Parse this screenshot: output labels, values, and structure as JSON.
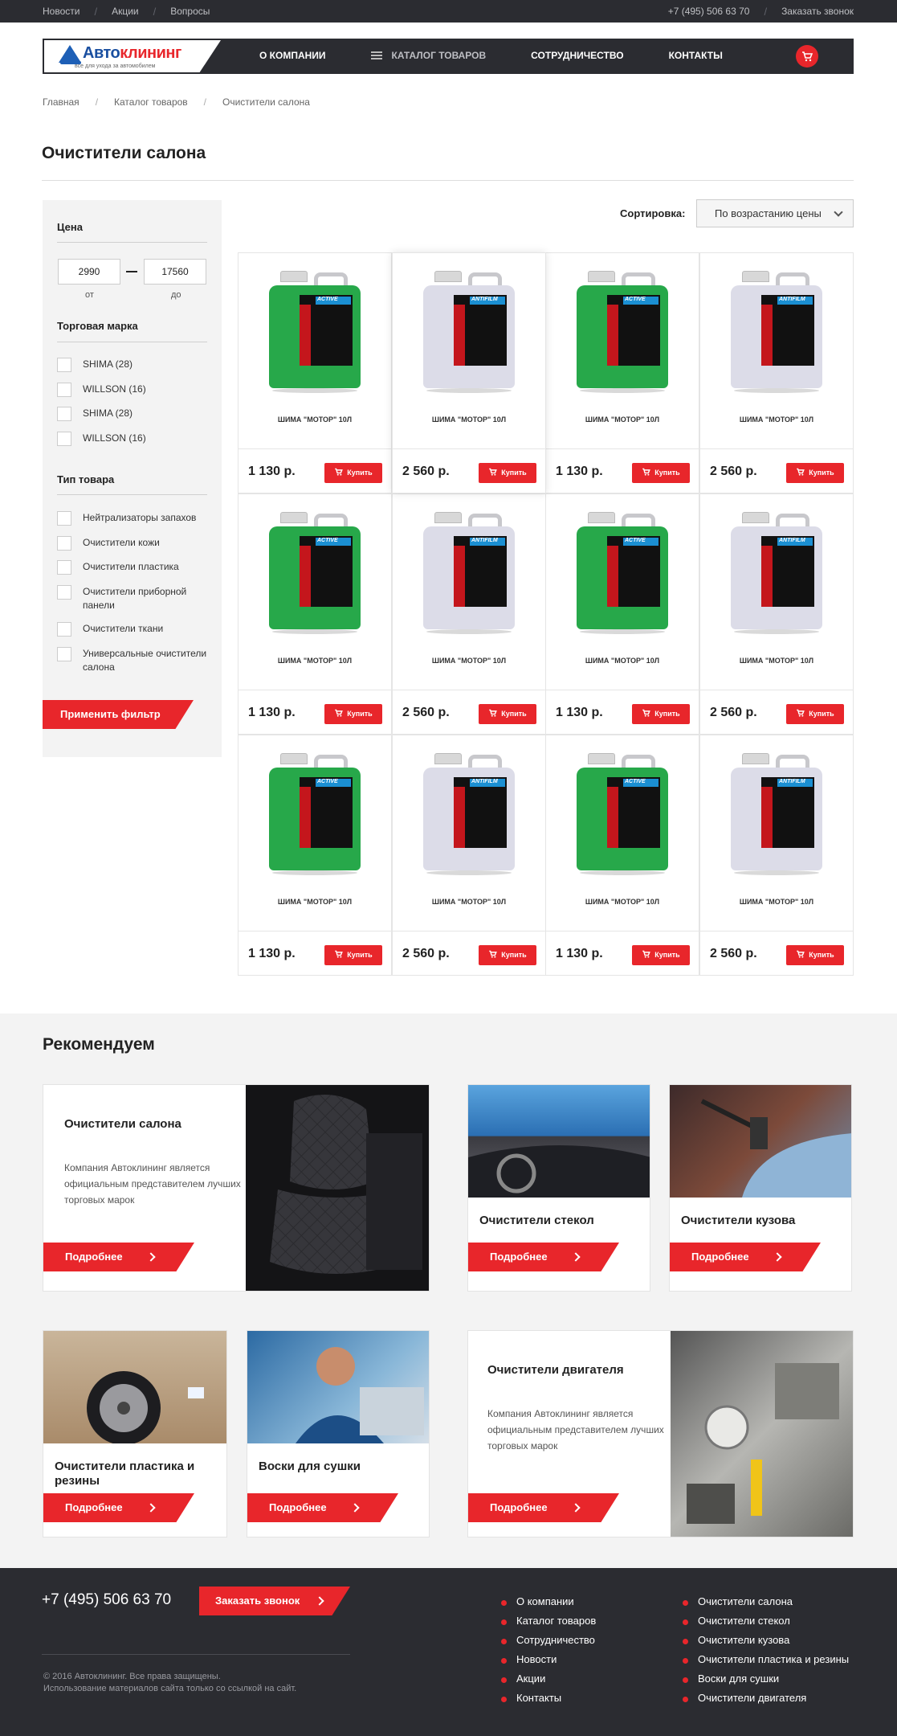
{
  "topbar": {
    "nav": [
      "Новости",
      "Акции",
      "Вопросы"
    ],
    "phone": "+7 (495) 506 63 70",
    "callback": "Заказать звонок"
  },
  "header": {
    "logo_main": "Авто",
    "logo_accent": "клининг",
    "logo_tagline": "все для ухода за автомобилем",
    "nav": {
      "about": "О КОМПАНИИ",
      "catalog": "КАТАЛОГ ТОВАРОВ",
      "partners": "СОТРУДНИЧЕСТВО",
      "contacts": "КОНТАКТЫ"
    },
    "cart_icon": "cart-icon"
  },
  "breadcrumbs": [
    "Главная",
    "Каталог товаров",
    "Очистители салона"
  ],
  "page_title": "Очистители салона",
  "filter": {
    "price_heading": "Цена",
    "price_from": "2990",
    "price_to": "17560",
    "from_label": "от",
    "to_label": "до",
    "brand_heading": "Торговая марка",
    "brands": [
      "SHIMA (28)",
      "WILLSON (16)",
      "SHIMA (28)",
      "WILLSON (16)"
    ],
    "type_heading": "Тип товара",
    "types": [
      "Нейтрализаторы запахов",
      "Очистители кожи",
      "Очистители пластика",
      "Очистители приборной панели",
      "Очистители ткани",
      "Универсальные очистители салона"
    ],
    "apply_label": "Применить фильтр"
  },
  "sort": {
    "label": "Сортировка:",
    "value": "По возрастанию цены"
  },
  "products": [
    {
      "name": "ШИМА \"МОТОР\" 10Л",
      "price": "1 130 р.",
      "buy": "Купить",
      "color": "green",
      "label": "ACTIVE"
    },
    {
      "name": "ШИМА \"МОТОР\" 10Л",
      "price": "2 560 р.",
      "buy": "Купить",
      "color": "white",
      "label": "ANTIFILM"
    },
    {
      "name": "ШИМА \"МОТОР\" 10Л",
      "price": "1 130 р.",
      "buy": "Купить",
      "color": "green",
      "label": "ACTIVE"
    },
    {
      "name": "ШИМА \"МОТОР\" 10Л",
      "price": "2 560 р.",
      "buy": "Купить",
      "color": "white",
      "label": "ANTIFILM"
    },
    {
      "name": "ШИМА \"МОТОР\" 10Л",
      "price": "1 130 р.",
      "buy": "Купить",
      "color": "green",
      "label": "ACTIVE"
    },
    {
      "name": "ШИМА \"МОТОР\" 10Л",
      "price": "2 560 р.",
      "buy": "Купить",
      "color": "white",
      "label": "ANTIFILM"
    },
    {
      "name": "ШИМА \"МОТОР\" 10Л",
      "price": "1 130 р.",
      "buy": "Купить",
      "color": "green",
      "label": "ACTIVE"
    },
    {
      "name": "ШИМА \"МОТОР\" 10Л",
      "price": "2 560 р.",
      "buy": "Купить",
      "color": "white",
      "label": "ANTIFILM"
    },
    {
      "name": "ШИМА \"МОТОР\" 10Л",
      "price": "1 130 р.",
      "buy": "Купить",
      "color": "green",
      "label": "ACTIVE"
    },
    {
      "name": "ШИМА \"МОТОР\" 10Л",
      "price": "2 560 р.",
      "buy": "Купить",
      "color": "white",
      "label": "ANTIFILM"
    },
    {
      "name": "ШИМА \"МОТОР\" 10Л",
      "price": "1 130 р.",
      "buy": "Купить",
      "color": "green",
      "label": "ACTIVE"
    },
    {
      "name": "ШИМА \"МОТОР\" 10Л",
      "price": "2 560 р.",
      "buy": "Купить",
      "color": "white",
      "label": "ANTIFILM"
    }
  ],
  "recommended": {
    "heading": "Рекомендуем",
    "more_label": "Подробнее",
    "description": "Компания Автоклининг является официальным представителем лучших торговых марок",
    "items": [
      "Очистители салона",
      "Очистители стекол",
      "Очистители кузова",
      "Очистители пластика и резины",
      "Воски для сушки",
      "Очистители двигателя"
    ]
  },
  "footer": {
    "phone": "+7 (495) 506 63 70",
    "callback": "Заказать звонок",
    "copyright_line1": "© 2016 Автоклининг. Все права защищены.",
    "copyright_line2": "Использование материалов сайта только со ссылкой на сайт.",
    "links_col1": [
      "О компании",
      "Каталог товаров",
      "Сотрудничество",
      "Новости",
      "Акции",
      "Контакты"
    ],
    "links_col2": [
      "Очистители салона",
      "Очистители стекол",
      "Очистители кузова",
      "Очистители пластика и резины",
      "Воски для сушки",
      "Очистители двигателя"
    ]
  },
  "colors": {
    "accent": "#e8262b",
    "dark": "#2b2c31",
    "brand_blue": "#1a4fa0"
  }
}
